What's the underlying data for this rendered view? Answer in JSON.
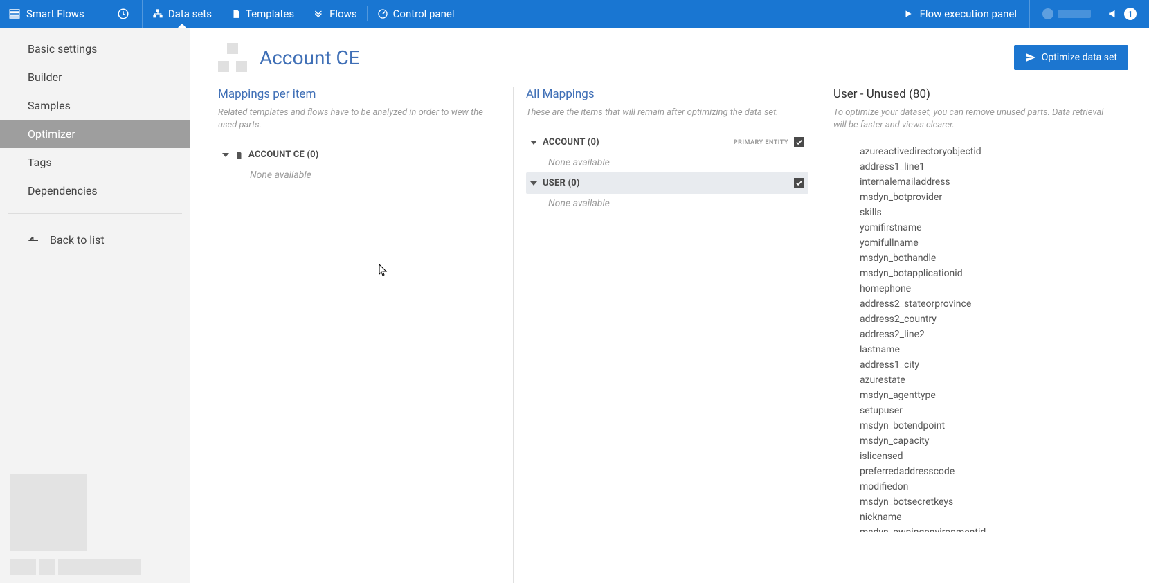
{
  "brand": "Smart Flows",
  "topnav": {
    "datasets": "Data sets",
    "templates": "Templates",
    "flows": "Flows",
    "control_panel": "Control panel"
  },
  "top_right": {
    "exec_panel": "Flow execution panel",
    "announce_count": "1"
  },
  "sidebar": {
    "items": [
      "Basic settings",
      "Builder",
      "Samples",
      "Optimizer",
      "Tags",
      "Dependencies"
    ],
    "active_index": 3,
    "back": "Back to list"
  },
  "page": {
    "title": "Account CE",
    "optimize_btn": "Optimize data set"
  },
  "col1": {
    "title": "Mappings per item",
    "desc": "Related templates and flows have to be analyzed in order to view the used parts.",
    "row_label": "ACCOUNT CE (0)",
    "none": "None available"
  },
  "col2": {
    "title": "All Mappings",
    "desc": "These are the items that will remain after optimizing the data set.",
    "row1_label": "ACCOUNT (0)",
    "row1_tag": "PRIMARY ENTITY",
    "row1_none": "None available",
    "row2_label": "USER (0)",
    "row2_none": "None available"
  },
  "col3": {
    "title": "User - Unused (80)",
    "desc": "To optimize your dataset, you can remove unused parts. Data retrieval will be faster and views clearer.",
    "fields": [
      "azureactivedirectoryobjectid",
      "address1_line1",
      "internalemailaddress",
      "msdyn_botprovider",
      "skills",
      "yomifirstname",
      "yomifullname",
      "msdyn_bothandle",
      "msdyn_botapplicationid",
      "homephone",
      "address2_stateorprovince",
      "address2_country",
      "address2_line2",
      "lastname",
      "address1_city",
      "azurestate",
      "msdyn_agenttype",
      "setupuser",
      "msdyn_botendpoint",
      "msdyn_capacity",
      "islicensed",
      "preferredaddresscode",
      "modifiedon",
      "msdyn_botsecretkeys",
      "nickname",
      "msdyn_owningenvironmentid"
    ]
  }
}
